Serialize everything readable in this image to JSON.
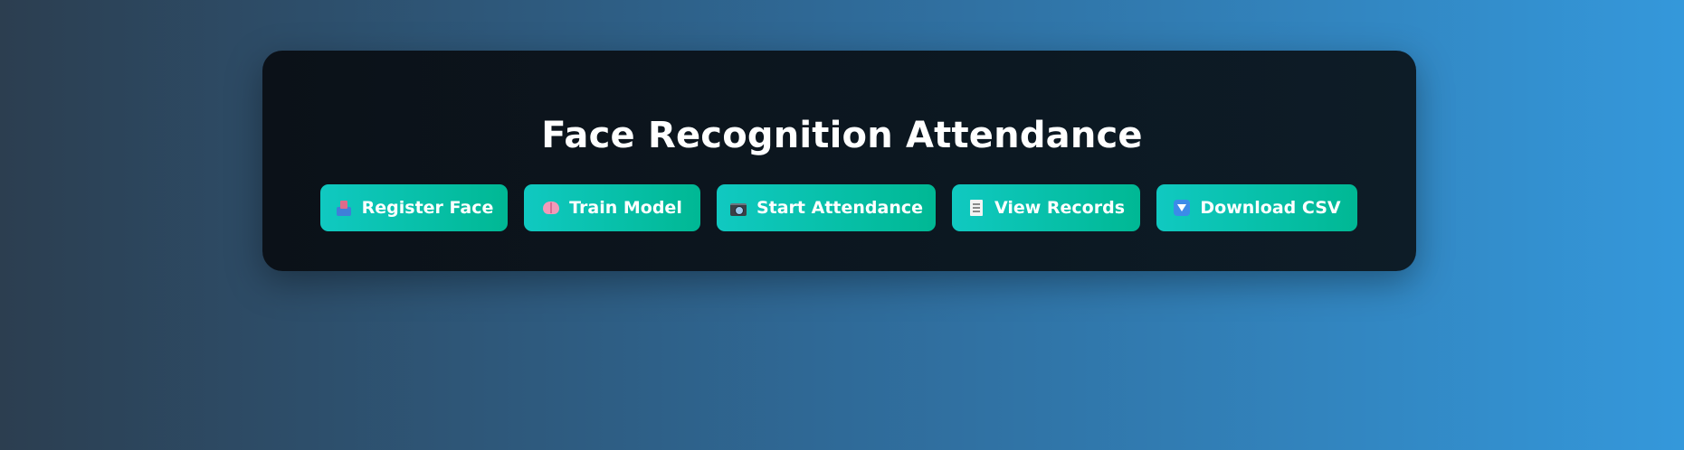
{
  "page": {
    "title": "Face Recognition Attendance"
  },
  "buttons": [
    {
      "label": "Register Face",
      "icon": "inbox-tray-icon"
    },
    {
      "label": "Train Model",
      "icon": "brain-icon"
    },
    {
      "label": "Start Attendance",
      "icon": "camera-icon"
    },
    {
      "label": "View Records",
      "icon": "receipt-icon"
    },
    {
      "label": "Download CSV",
      "icon": "down-arrow-icon"
    }
  ],
  "colors": {
    "background_start": "#2c3e50",
    "background_end": "#3498db",
    "card": "#0d1821",
    "button_start": "#10c9c1",
    "button_end": "#00b894",
    "text": "#ffffff"
  }
}
